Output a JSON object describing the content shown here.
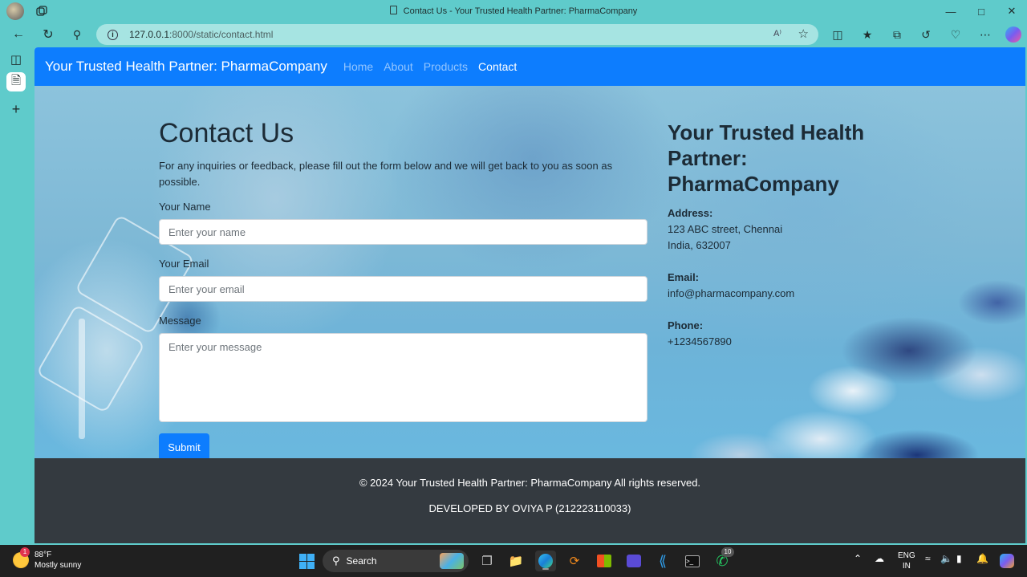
{
  "browser": {
    "tab_title": "Contact Us - Your Trusted Health Partner: PharmaCompany",
    "url_host": "127.0.0.1",
    "url_rest": ":8000/static/contact.html",
    "read_aloud": "A⁾"
  },
  "site": {
    "brand": "Your Trusted Health Partner: PharmaCompany",
    "nav": [
      {
        "label": "Home",
        "active": false
      },
      {
        "label": "About",
        "active": false
      },
      {
        "label": "Products",
        "active": false
      },
      {
        "label": "Contact",
        "active": true
      }
    ]
  },
  "contact": {
    "heading": "Contact Us",
    "lead": "For any inquiries or feedback, please fill out the form below and we will get back to you as soon as possible.",
    "name_label": "Your Name",
    "name_placeholder": "Enter your name",
    "email_label": "Your Email",
    "email_placeholder": "Enter your email",
    "message_label": "Message",
    "message_placeholder": "Enter your message",
    "submit_label": "Submit"
  },
  "info": {
    "heading": "Your Trusted Health Partner: PharmaCompany",
    "address_label": "Address:",
    "address_line1": "123 ABC street, Chennai",
    "address_line2": "India, 632007",
    "email_label": "Email:",
    "email_value": "info@pharmacompany.com",
    "phone_label": "Phone:",
    "phone_value": "+1234567890"
  },
  "footer": {
    "copyright": "© 2024 Your Trusted Health Partner: PharmaCompany All rights reserved.",
    "developer": "DEVELOPED BY OVIYA P (212223110033)"
  },
  "taskbar": {
    "temperature": "88°F",
    "condition": "Mostly sunny",
    "weather_badge": "1",
    "search_label": "Search",
    "whatsapp_badge": "10",
    "lang_top": "ENG",
    "lang_bottom": "IN"
  }
}
